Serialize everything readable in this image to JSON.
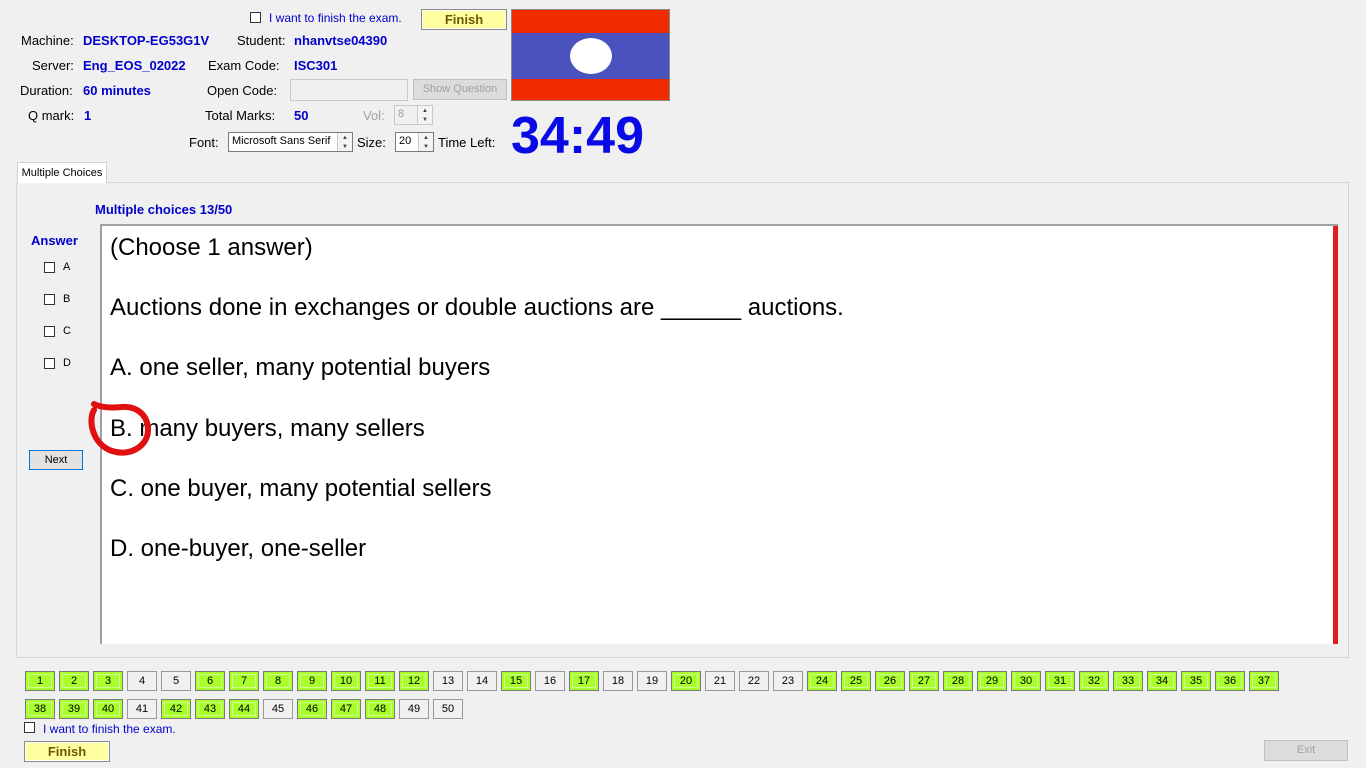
{
  "header": {
    "finish_check_label": "I want to finish the exam.",
    "finish_label": "Finish",
    "machine_label": "Machine:",
    "machine_value": "DESKTOP-EG53G1V",
    "student_label": "Student:",
    "student_value": "nhanvtse04390",
    "server_label": "Server:",
    "server_value": "Eng_EOS_02022",
    "exam_code_label": "Exam Code:",
    "exam_code_value": "ISC301",
    "duration_label": "Duration:",
    "duration_value": "60 minutes",
    "open_code_label": "Open Code:",
    "open_code_value": "",
    "show_question_label": "Show Question",
    "qmark_label": "Q mark:",
    "qmark_value": "1",
    "total_marks_label": "Total Marks:",
    "total_marks_value": "50",
    "vol_label": "Vol:",
    "vol_value": "8",
    "font_label": "Font:",
    "font_value": "Microsoft Sans Serif",
    "size_label": "Size:",
    "size_value": "20",
    "time_left_label": "Time Left:",
    "time_left_value": "34:49",
    "flag_colors": {
      "red": "#f02b00",
      "blue": "#4a52be",
      "white": "#ffffff"
    }
  },
  "tab": {
    "label": "Multiple Choices"
  },
  "question": {
    "progress": "Multiple choices 13/50",
    "answer_heading": "Answer",
    "answer_options": [
      "A",
      "B",
      "C",
      "D"
    ],
    "next_label": "Next",
    "lines": [
      "(Choose 1 answer)",
      "Auctions done in exchanges or double auctions are ______ auctions.",
      "A.  one seller, many potential buyers",
      "B.  many buyers, many sellers",
      "C.  one buyer, many potential sellers",
      "D.  one-buyer, one-seller"
    ],
    "scroll_bar_color": "#e21b1b",
    "annotation_color": "#e01010"
  },
  "navigator": {
    "questions": [
      {
        "n": "1",
        "done": true
      },
      {
        "n": "2",
        "done": true
      },
      {
        "n": "3",
        "done": true
      },
      {
        "n": "4",
        "done": false
      },
      {
        "n": "5",
        "done": false
      },
      {
        "n": "6",
        "done": true
      },
      {
        "n": "7",
        "done": true
      },
      {
        "n": "8",
        "done": true
      },
      {
        "n": "9",
        "done": true
      },
      {
        "n": "10",
        "done": true
      },
      {
        "n": "11",
        "done": true
      },
      {
        "n": "12",
        "done": true
      },
      {
        "n": "13",
        "done": false
      },
      {
        "n": "14",
        "done": false
      },
      {
        "n": "15",
        "done": true
      },
      {
        "n": "16",
        "done": false
      },
      {
        "n": "17",
        "done": true
      },
      {
        "n": "18",
        "done": false
      },
      {
        "n": "19",
        "done": false
      },
      {
        "n": "20",
        "done": true
      },
      {
        "n": "21",
        "done": false
      },
      {
        "n": "22",
        "done": false
      },
      {
        "n": "23",
        "done": false
      },
      {
        "n": "24",
        "done": true
      },
      {
        "n": "25",
        "done": true
      },
      {
        "n": "26",
        "done": true
      },
      {
        "n": "27",
        "done": true
      },
      {
        "n": "28",
        "done": true
      },
      {
        "n": "29",
        "done": true
      },
      {
        "n": "30",
        "done": true
      },
      {
        "n": "31",
        "done": true
      },
      {
        "n": "32",
        "done": true
      },
      {
        "n": "33",
        "done": true
      },
      {
        "n": "34",
        "done": true
      },
      {
        "n": "35",
        "done": true
      },
      {
        "n": "36",
        "done": true
      },
      {
        "n": "37",
        "done": true
      },
      {
        "n": "38",
        "done": true
      },
      {
        "n": "39",
        "done": true
      },
      {
        "n": "40",
        "done": true
      },
      {
        "n": "41",
        "done": false
      },
      {
        "n": "42",
        "done": true
      },
      {
        "n": "43",
        "done": true
      },
      {
        "n": "44",
        "done": true
      },
      {
        "n": "45",
        "done": false
      },
      {
        "n": "46",
        "done": true
      },
      {
        "n": "47",
        "done": true
      },
      {
        "n": "48",
        "done": true
      },
      {
        "n": "49",
        "done": false
      },
      {
        "n": "50",
        "done": false
      }
    ],
    "done_color": "#a8ff2a"
  },
  "footer": {
    "finish_check_label": "I want to finish the exam.",
    "finish_label": "Finish",
    "exit_label": "Exit"
  }
}
